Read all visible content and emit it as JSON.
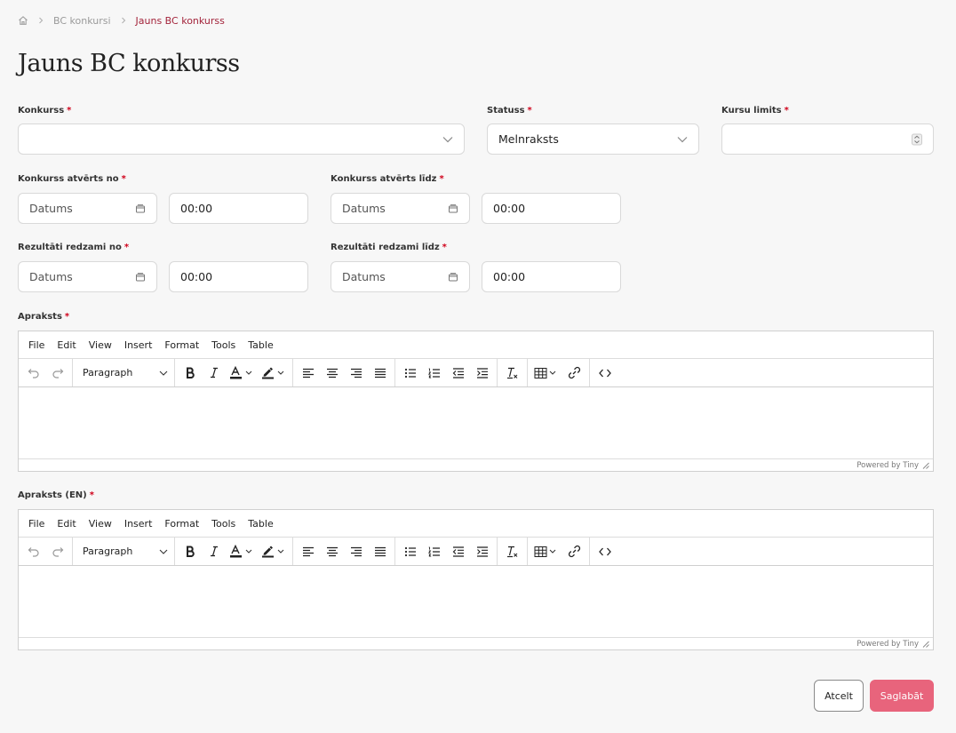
{
  "breadcrumb": {
    "home_icon": "home-icon",
    "items": [
      "BC konkursi",
      "Jauns BC konkurss"
    ]
  },
  "page_title": "Jauns BC konkurss",
  "fields": {
    "konkurss": {
      "label": "Konkurss",
      "value": ""
    },
    "statuss": {
      "label": "Statuss",
      "value": "Melnraksts"
    },
    "kursu_limits": {
      "label": "Kursu limits",
      "value": ""
    },
    "atverts_no": {
      "label": "Konkurss atvērts no",
      "date_placeholder": "Datums",
      "time": "00:00"
    },
    "atverts_lidz": {
      "label": "Konkurss atvērts līdz",
      "date_placeholder": "Datums",
      "time": "00:00"
    },
    "rezultati_no": {
      "label": "Rezultāti redzami no",
      "date_placeholder": "Datums",
      "time": "00:00"
    },
    "rezultati_lidz": {
      "label": "Rezultāti redzami līdz",
      "date_placeholder": "Datums",
      "time": "00:00"
    }
  },
  "required_mark": "*",
  "editors": [
    {
      "label": "Apraksts"
    },
    {
      "label": "Apraksts (EN)"
    }
  ],
  "editor_ui": {
    "menu": [
      "File",
      "Edit",
      "View",
      "Insert",
      "Format",
      "Tools",
      "Table"
    ],
    "format_value": "Paragraph",
    "powered_by": "Powered by Tiny"
  },
  "buttons": {
    "cancel": "Atcelt",
    "save": "Saglabāt"
  },
  "colors": {
    "accent": "#a3243b",
    "required": "#d0021b",
    "save_button": "#e8647c"
  }
}
